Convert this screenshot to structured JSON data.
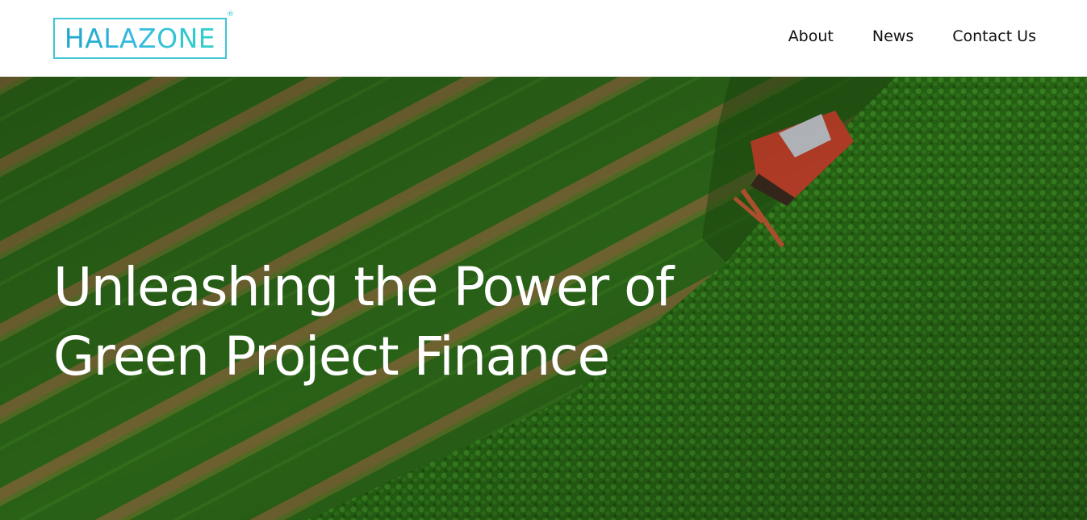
{
  "header": {
    "logo": {
      "text": "HALAZONE",
      "registered": "®",
      "color": "#3ec5d6"
    },
    "nav": [
      {
        "label": "About"
      },
      {
        "label": "News"
      },
      {
        "label": "Contact Us"
      }
    ]
  },
  "hero": {
    "title_line1": "Unleashing the Power of",
    "title_line2": "Green Project Finance",
    "image": "aerial-farm-field-with-tractor"
  },
  "colors": {
    "accent": "#3ec5d6",
    "field_dark": "#1f5a12",
    "field_light": "#3f8e22",
    "row_stripe": "#8a7a3c",
    "tractor": "#d0462c"
  }
}
